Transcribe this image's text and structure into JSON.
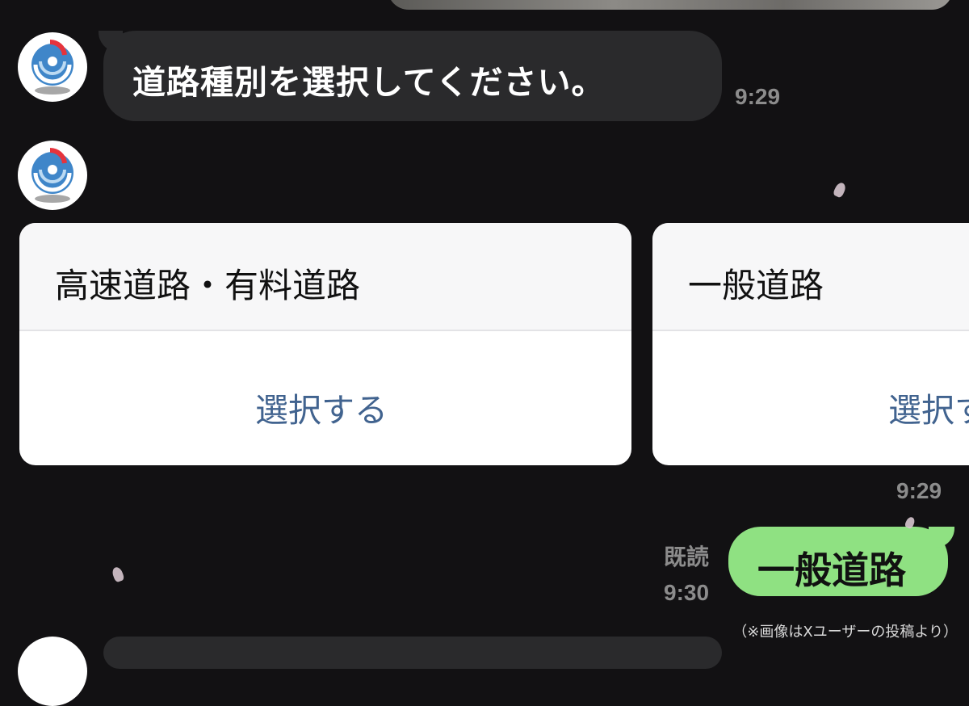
{
  "messages": {
    "bot_prompt": "道路種別を選択してください。",
    "bot_prompt_time": "9:29",
    "carousel_time": "9:29",
    "user_reply": "一般道路",
    "user_read_label": "既読",
    "user_reply_time": "9:30"
  },
  "carousel": {
    "cards": [
      {
        "title": "高速道路・有料道路",
        "action": "選択する"
      },
      {
        "title": "一般道路",
        "action": "選択する"
      }
    ]
  },
  "caption": "（※画像はXユーザーの投稿より）",
  "colors": {
    "background": "#121113",
    "incoming_bubble": "#2a2a2c",
    "outgoing_bubble": "#8fe182",
    "action_link": "#41638f"
  },
  "icons": {
    "avatar": "mlit-logo-icon"
  }
}
